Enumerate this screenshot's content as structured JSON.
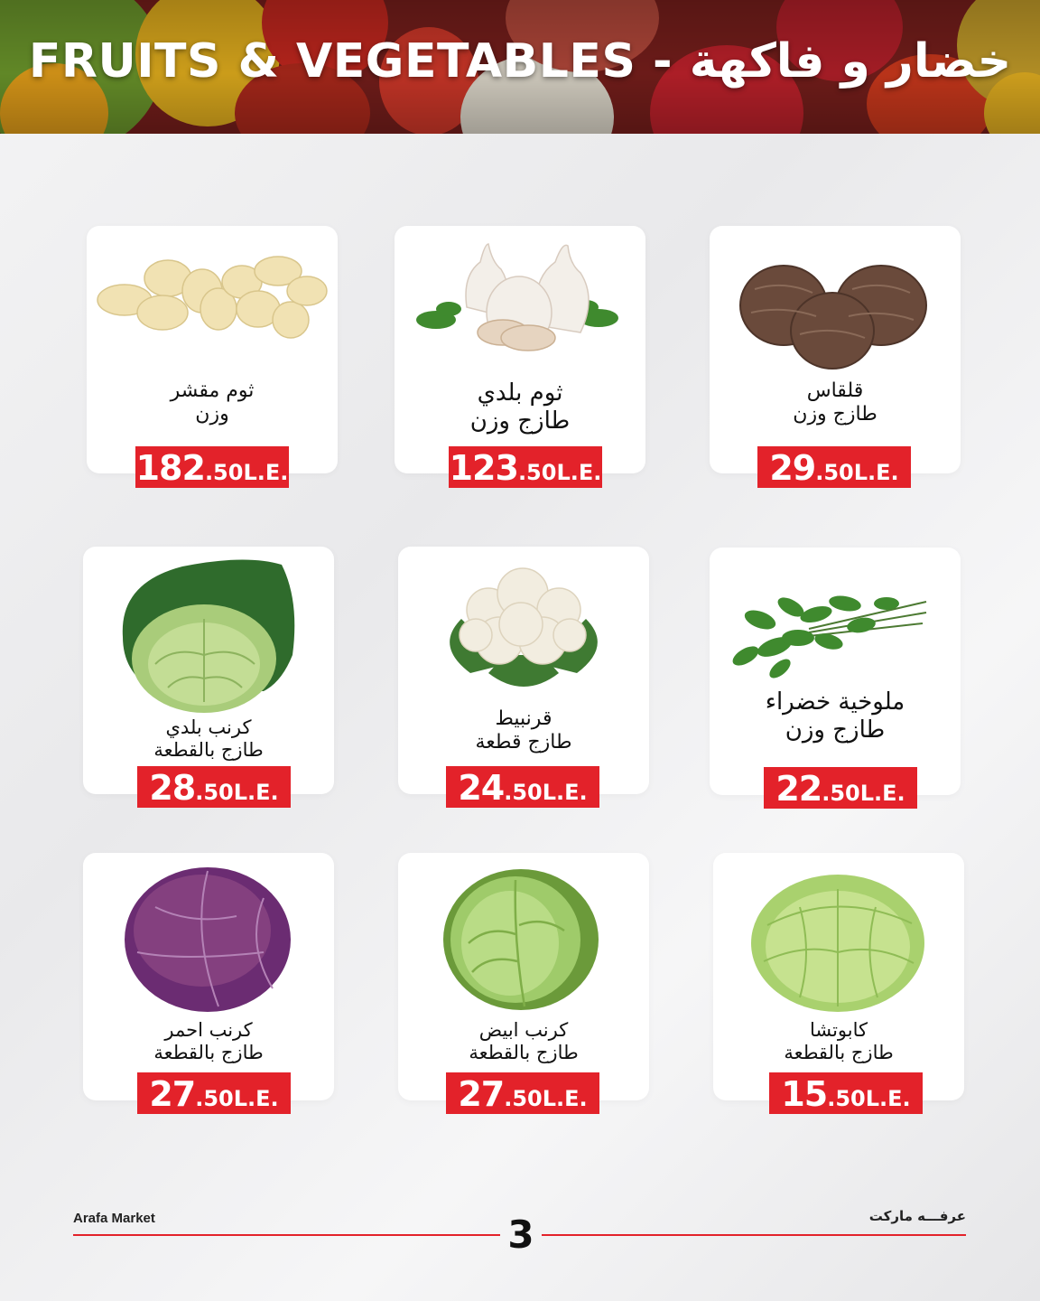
{
  "header": {
    "title": "FRUITS & VEGETABLES - خضار و فاكهة"
  },
  "products": [
    {
      "name_line1": "ثوم مقشر",
      "name_line2": "وزن",
      "price_main": "182",
      "price_suffix": ".50L.E.",
      "image": "peeled-garlic"
    },
    {
      "name_line1": "ثوم بلدي",
      "name_line2": "طازج وزن",
      "price_main": "123",
      "price_suffix": ".50L.E.",
      "image": "garlic-bulbs"
    },
    {
      "name_line1": "قلقاس",
      "name_line2": "طازج وزن",
      "price_main": "29",
      "price_suffix": ".50L.E.",
      "image": "taro"
    },
    {
      "name_line1": "كرنب بلدي",
      "name_line2": "طازج بالقطعة",
      "price_main": "28",
      "price_suffix": ".50L.E.",
      "image": "savoy-cabbage"
    },
    {
      "name_line1": "قرنبيط",
      "name_line2": "طازج قطعة",
      "price_main": "24",
      "price_suffix": ".50L.E.",
      "image": "cauliflower"
    },
    {
      "name_line1": "ملوخية خضراء",
      "name_line2": "طازج وزن",
      "price_main": "22",
      "price_suffix": ".50L.E.",
      "image": "molokhia"
    },
    {
      "name_line1": "كرنب احمر",
      "name_line2": "طازج بالقطعة",
      "price_main": "27",
      "price_suffix": ".50L.E.",
      "image": "red-cabbage"
    },
    {
      "name_line1": "كرنب ابيض",
      "name_line2": "طازج بالقطعة",
      "price_main": "27",
      "price_suffix": ".50L.E.",
      "image": "white-cabbage"
    },
    {
      "name_line1": "كابوتشا",
      "name_line2": "طازج بالقطعة",
      "price_main": "15",
      "price_suffix": ".50L.E.",
      "image": "iceberg-lettuce"
    }
  ],
  "footer": {
    "brand_en": "Arafa Market",
    "brand_ar": "عرفـــه ماركت",
    "page_number": "3"
  },
  "colors": {
    "accent": "#e3222a",
    "card": "#ffffff",
    "background": "#eeeeef"
  }
}
